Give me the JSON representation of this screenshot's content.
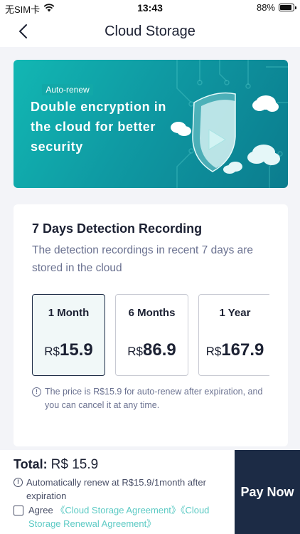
{
  "status_bar": {
    "carrier": "无SIM卡",
    "time": "13:43",
    "battery_percent": "88%",
    "battery_level": 0.88,
    "icons": [
      "wifi-icon",
      "battery-icon"
    ]
  },
  "nav": {
    "title": "Cloud Storage",
    "back_icon": "chevron-left-icon"
  },
  "banner": {
    "text": "Double encryption in the cloud for better security"
  },
  "plan_card": {
    "title": "7 Days Detection Recording",
    "description": "The detection recordings in recent 7 days are stored in the cloud",
    "badge": "Auto-renew",
    "plans": [
      {
        "name": "1 Month",
        "currency": "R$",
        "amount": "15.9",
        "selected": true
      },
      {
        "name": "6 Months",
        "currency": "R$",
        "amount": "86.9",
        "selected": false
      },
      {
        "name": "1 Year",
        "currency": "R$",
        "amount": "167.9",
        "selected": false
      }
    ],
    "price_note": "The price is R$15.9 for auto-renew after expiration, and you can cancel it at any time."
  },
  "checkout": {
    "total_label": "Total:",
    "total_value": "R$ 15.9",
    "renew_note": "Automatically renew at R$15.9/1month after expiration",
    "agree_prefix": "Agree",
    "agreement_link": "《Cloud Storage Agreement》",
    "renewal_link": "《Cloud Storage Renewal Agreement》",
    "pay_label": "Pay Now"
  },
  "colors": {
    "primary_dark": "#1c2b45",
    "accent_teal": "#12a8a8",
    "link": "#5ccac4",
    "banner_start": "#12b7b3",
    "banner_end": "#0b7c8e"
  }
}
